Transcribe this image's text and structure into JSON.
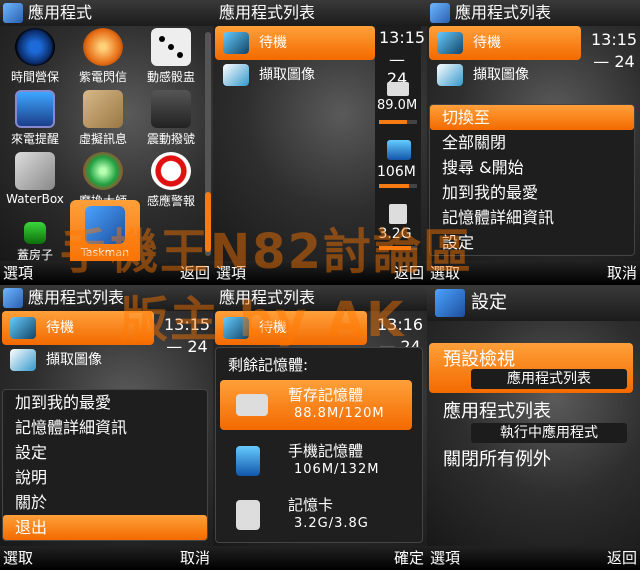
{
  "colors": {
    "accent": "#f77b10",
    "dark": "#1e1e1e"
  },
  "watermark": {
    "line1": "手機王N82討論區",
    "line2": "版主 by AK"
  },
  "p1": {
    "title": "應用程式",
    "apps": [
      {
        "label": "時間營保",
        "icon": "spiral-icon"
      },
      {
        "label": "紫電閃信",
        "icon": "orb-icon"
      },
      {
        "label": "動感骰盅",
        "icon": "dice-icon"
      },
      {
        "label": "來電提醒",
        "icon": "screen-icon"
      },
      {
        "label": "虛擬訊息",
        "icon": "envelope-icon"
      },
      {
        "label": "震動撥號",
        "icon": "ghost-icon"
      },
      {
        "label": "WaterBox",
        "icon": "cube-icon"
      },
      {
        "label": "魔換大師",
        "icon": "swap-icon"
      },
      {
        "label": "感應警報",
        "icon": "no-sign-icon"
      },
      {
        "label": "蓋房子",
        "icon": "building-icon"
      },
      {
        "label": "Taskman",
        "icon": "taskman-icon"
      }
    ],
    "soft_left": "選項",
    "soft_right": "返回"
  },
  "p2": {
    "title": "應用程式列表",
    "items": [
      "待機",
      "擷取圖像"
    ],
    "time": "13:15",
    "date": "— 24",
    "ram_value": "89.0M",
    "phone_value": "106M",
    "card_value": "3.2G",
    "ram_fill": 0.74,
    "phone_fill": 0.8,
    "card_fill": 0.84,
    "soft_left": "選項",
    "soft_right": "返回"
  },
  "p3": {
    "title": "應用程式列表",
    "items": [
      "待機",
      "擷取圖像"
    ],
    "time": "13:15",
    "date": "— 24",
    "menu": [
      "切換至",
      "全部關閉",
      "搜尋 &開始",
      "加到我的最愛",
      "記憶體詳細資訊",
      "設定"
    ],
    "soft_left": "選取",
    "soft_right": "取消"
  },
  "p4": {
    "title": "應用程式列表",
    "items": [
      "待機",
      "擷取圖像"
    ],
    "time": "13:15",
    "date": "— 24",
    "menu": [
      "加到我的最愛",
      "記憶體詳細資訊",
      "設定",
      "說明",
      "關於",
      "退出"
    ],
    "soft_left": "選取",
    "soft_right": "取消"
  },
  "p5": {
    "title": "應用程式列表",
    "items": [
      "待機"
    ],
    "time": "13:16",
    "date": "— 24",
    "dialog_title": "剩餘記憶體:",
    "mem": [
      {
        "name": "暫存記憶體",
        "value": "88.8M/120M",
        "icon": "ram-icon"
      },
      {
        "name": "手機記憶體",
        "value": "106M/132M",
        "icon": "phone-icon"
      },
      {
        "name": "記憶卡",
        "value": "3.2G/3.8G",
        "icon": "memory-card-icon"
      }
    ],
    "soft_right": "確定"
  },
  "p6": {
    "title": "設定",
    "rows": [
      {
        "label": "預設檢視",
        "value": "應用程式列表"
      },
      {
        "label": "應用程式列表",
        "value": "執行中應用程式"
      },
      {
        "label": "關閉所有例外",
        "value": ""
      }
    ],
    "soft_left": "選項",
    "soft_right": "返回"
  }
}
